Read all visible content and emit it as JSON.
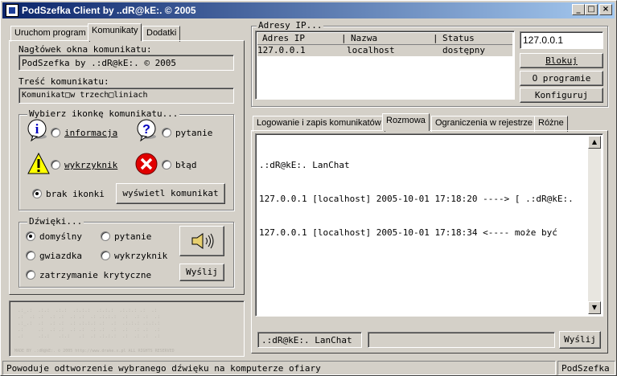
{
  "window": {
    "title": "PodSzefka Client by ..dR@kE:. © 2005",
    "minimize": "_",
    "maximize": "□",
    "close": "×"
  },
  "left_tabs": [
    "Uruchom program",
    "Komunikaty",
    "Dodatki"
  ],
  "message": {
    "header_label": "Nagłówek okna komunikatu:",
    "header_value": "PodSzefka by .:dR@kE:. © 2005",
    "body_label": "Treść komunikatu:",
    "body_value": "Komunikat□w trzech□liniach"
  },
  "icon_group": {
    "legend": "Wybierz ikonkę komunikatu...",
    "options": [
      "informacja",
      "pytanie",
      "wykrzyknik",
      "błąd"
    ],
    "no_icon": "brak ikonki",
    "show_button": "wyświetl komunikat"
  },
  "sound_group": {
    "legend": "Dźwięki...",
    "options": [
      "domyślny",
      "pytanie",
      "gwiazdka",
      "wykrzyknik",
      "zatrzymanie krytyczne"
    ],
    "send_button": "Wyślij"
  },
  "watermark": {
    "footer": "MADE BY .:dR@kE:. © 2005 http://www.drake.x.pl ALL RIGHTS RESERVED"
  },
  "ip_panel": {
    "legend": "Adresy IP...",
    "columns": [
      "Adres IP",
      "Nazwa",
      "Status"
    ],
    "rows": [
      {
        "ip": "127.0.0.1",
        "name": "localhost",
        "status": "dostępny"
      }
    ],
    "ip_input": "127.0.0.1",
    "buttons": [
      "Blokuj",
      "O programie",
      "Konfiguruj"
    ]
  },
  "right_tabs": [
    "Logowanie i zapis komunikatów",
    "Rozmowa",
    "Ograniczenia w rejestrze",
    "Różne"
  ],
  "chat": {
    "lines": [
      ".:dR@kE:. LanChat",
      "127.0.0.1 [localhost] 2005-10-01 17:18:20 ----> [ .:dR@kE:.",
      "127.0.0.1 [localhost] 2005-10-01 17:18:34 <---- może być"
    ],
    "name_field": ".:dR@kE:. LanChat",
    "input_value": "",
    "send_button": "Wyślij"
  },
  "status_bar": {
    "text": "Powoduje odtworzenie wybranego dźwięku na komputerze ofiary",
    "right": "PodSzefka"
  }
}
